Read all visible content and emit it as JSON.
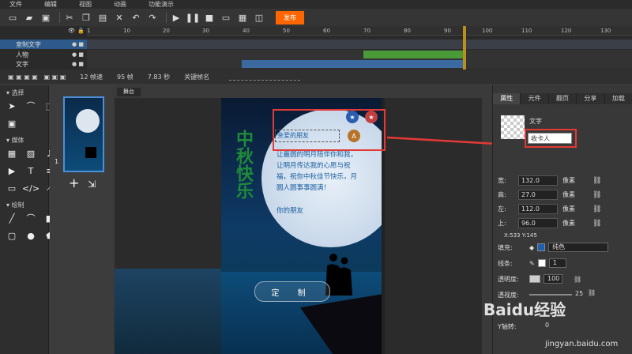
{
  "menu": [
    "文件",
    "编辑",
    "视图",
    "动画",
    "功能演示"
  ],
  "toolbar": {
    "publish_label": "发布"
  },
  "timeline": {
    "ticks": [
      "1",
      "10",
      "20",
      "30",
      "40",
      "50",
      "60",
      "70",
      "80",
      "90",
      "100",
      "110",
      "120",
      "130"
    ],
    "layers": [
      {
        "name": "室制文字"
      },
      {
        "name": "人物"
      },
      {
        "name": "文字"
      }
    ]
  },
  "status": {
    "fps": "12 帧速",
    "frames": "95 帧",
    "seconds": "7.83 秒",
    "keyframe_label": "关键帧名"
  },
  "left_panel": {
    "select": "选择",
    "media": "媒体",
    "draw": "绘制"
  },
  "thumbs": {
    "page_num": "1",
    "add": "+"
  },
  "stage": {
    "tab": "舞台",
    "title": "中秋快乐",
    "to_text": "亲爱的朋友",
    "greeting": "让最圆的明月陪伴你和我，让明月传达我的心愿与祝福，祝你中秋佳节快乐，月圆人圆事事圆满！",
    "signature": "你的朋友",
    "button_label": "定 制"
  },
  "props": {
    "tabs": [
      "属性",
      "元件",
      "翻页",
      "分享",
      "加载"
    ],
    "type_label": "文字",
    "name_value": "收卡人",
    "rows": [
      {
        "label": "宽:",
        "value": "132.0",
        "unit": "像素"
      },
      {
        "label": "高:",
        "value": "27.0",
        "unit": "像素"
      },
      {
        "label": "左:",
        "value": "112.0",
        "unit": "像素"
      },
      {
        "label": "上:",
        "value": "96.0",
        "unit": "像素"
      }
    ],
    "coords": "X:533   Y:145",
    "fill_label": "填充:",
    "fill_type": "纯色",
    "stroke_label": "线条:",
    "stroke_width": "1",
    "opacity_label": "透明度:",
    "opacity_value": "100",
    "blur_label": "透视度:",
    "blur_value": "25",
    "yrot_label": "Y轴转:",
    "yrot_value": "0"
  },
  "watermark": {
    "brand": "Baidu经验",
    "url": "jingyan.baidu.com"
  },
  "colors": {
    "accent": "#ff6600",
    "highlight": "#e53935",
    "green_bar": "#4a9a3a",
    "blue_bar": "#3a6aa0"
  }
}
